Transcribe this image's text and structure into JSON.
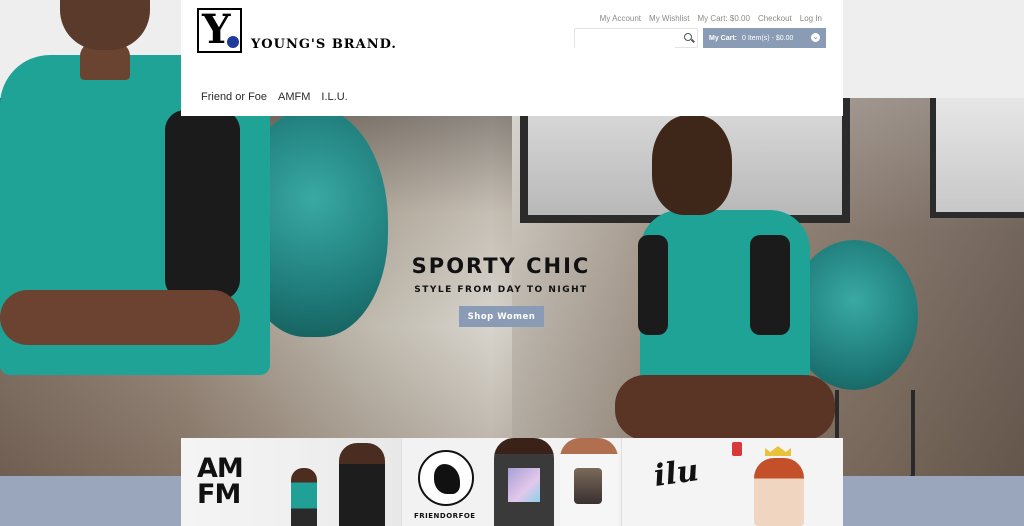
{
  "header": {
    "logo_letter": "Y",
    "logo_text": "YOUNG'S BRAND.",
    "top_links": [
      "My Account",
      "My Wishlist",
      "My Cart: $0.00",
      "Checkout",
      "Log In"
    ],
    "search": {
      "placeholder": "",
      "value": ""
    },
    "cart": {
      "label": "My Cart:",
      "summary": "0 Item(s) - $0.00"
    },
    "nav": [
      "Friend or Foe",
      "AMFM",
      "I.L.U."
    ]
  },
  "hero": {
    "title": "SPORTY CHIC",
    "subtitle": "STYLE FROM DAY TO NIGHT",
    "button_label": "Shop Women"
  },
  "brands": {
    "amfm": "AM\nFM",
    "friendorfoe": "FRIENDORFOE",
    "ilu": "ilu"
  },
  "colors": {
    "accent": "#8a9bb5",
    "teal": "#1fa396",
    "header_bg": "#ffffff",
    "link_gray": "#8b8b8b"
  }
}
